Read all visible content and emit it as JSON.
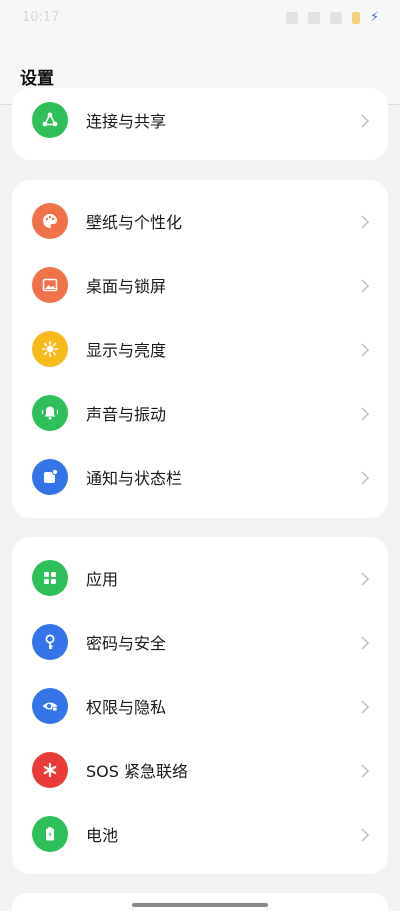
{
  "status_bar": {
    "time": "10:17"
  },
  "header": {
    "title": "设置"
  },
  "groups": [
    {
      "items": [
        {
          "label": "连接与共享",
          "icon": "share-icon",
          "color": "#2fbf5a"
        }
      ]
    },
    {
      "items": [
        {
          "label": "壁纸与个性化",
          "icon": "palette-icon",
          "color": "#f0714a"
        },
        {
          "label": "桌面与锁屏",
          "icon": "image-icon",
          "color": "#f0714a"
        },
        {
          "label": "显示与亮度",
          "icon": "sun-icon",
          "color": "#f8b91c"
        },
        {
          "label": "声音与振动",
          "icon": "bell-icon",
          "color": "#2fbf5a"
        },
        {
          "label": "通知与状态栏",
          "icon": "notification-icon",
          "color": "#3574e8"
        }
      ]
    },
    {
      "items": [
        {
          "label": "应用",
          "icon": "apps-grid-icon",
          "color": "#2fbf5a"
        },
        {
          "label": "密码与安全",
          "icon": "key-icon",
          "color": "#3574e8"
        },
        {
          "label": "权限与隐私",
          "icon": "privacy-eye-icon",
          "color": "#3574e8"
        },
        {
          "label": "SOS 紧急联络",
          "icon": "asterisk-icon",
          "color": "#ea3b3b"
        },
        {
          "label": "电池",
          "icon": "battery-icon",
          "color": "#2fbf5a"
        }
      ]
    }
  ]
}
